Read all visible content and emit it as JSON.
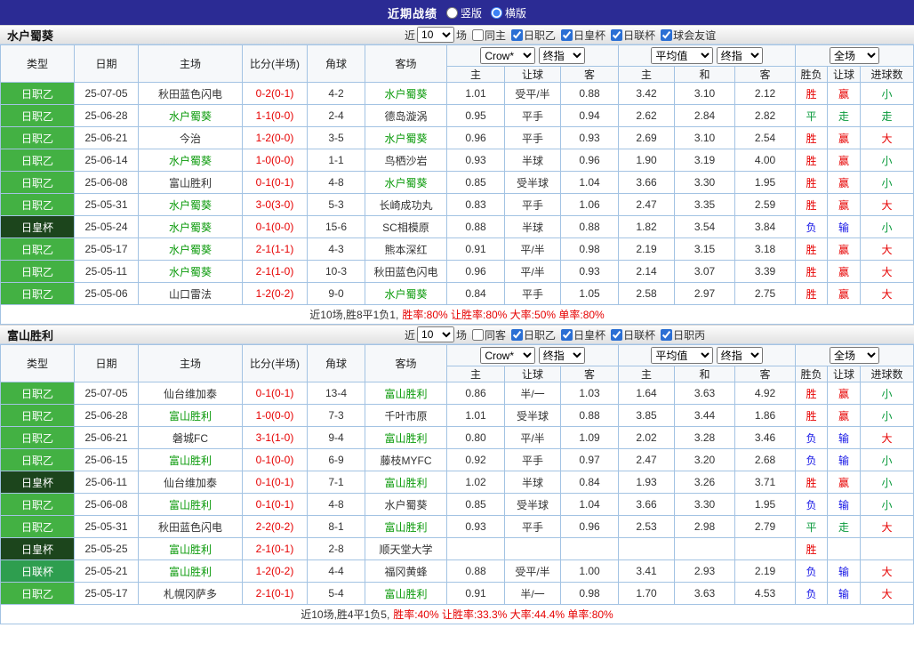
{
  "topbar": {
    "title": "近期战绩",
    "layout_options": [
      {
        "label": "竖版",
        "checked": false
      },
      {
        "label": "横版",
        "checked": true
      }
    ]
  },
  "filter_labels": {
    "near": "近",
    "games": "场"
  },
  "selects": {
    "count": "10",
    "bookmaker": "Crow*",
    "final_index_1": "终指",
    "average": "平均值",
    "final_index_2": "终指",
    "full_match": "全场"
  },
  "header_labels": {
    "type": "类型",
    "date": "日期",
    "home": "主场",
    "score": "比分(半场)",
    "corner": "角球",
    "away": "客场",
    "odds_home": "主",
    "odds_handicap": "让球",
    "odds_away": "客",
    "avg_home": "主",
    "avg_draw": "和",
    "avg_away": "客",
    "result_wdl": "胜负",
    "result_handicap": "让球",
    "result_goals": "进球数"
  },
  "sections": [
    {
      "team": "水户蜀葵",
      "filters": [
        {
          "label": "同主",
          "checked": false
        },
        {
          "label": "日职乙",
          "checked": true
        },
        {
          "label": "日皇杯",
          "checked": true
        },
        {
          "label": "日联杯",
          "checked": true
        },
        {
          "label": "球会友谊",
          "checked": true
        }
      ],
      "rows": [
        {
          "type": "日职乙",
          "date": "25-07-05",
          "home": "秋田蓝色闪电",
          "home_focus": false,
          "score": "0-2(0-1)",
          "corner": "4-2",
          "away": "水户蜀葵",
          "away_focus": true,
          "o1": "1.01",
          "handicap": "受平/半",
          "o2": "0.88",
          "a1": "3.42",
          "a2": "3.10",
          "a3": "2.12",
          "r1": "胜",
          "r2": "赢",
          "r3": "小"
        },
        {
          "type": "日职乙",
          "date": "25-06-28",
          "home": "水户蜀葵",
          "home_focus": true,
          "score": "1-1(0-0)",
          "corner": "2-4",
          "away": "德岛漩涡",
          "away_focus": false,
          "o1": "0.95",
          "handicap": "平手",
          "o2": "0.94",
          "a1": "2.62",
          "a2": "2.84",
          "a3": "2.82",
          "r1": "平",
          "r2": "走",
          "r3": "走"
        },
        {
          "type": "日职乙",
          "date": "25-06-21",
          "home": "今治",
          "home_focus": false,
          "score": "1-2(0-0)",
          "corner": "3-5",
          "away": "水户蜀葵",
          "away_focus": true,
          "o1": "0.96",
          "handicap": "平手",
          "o2": "0.93",
          "a1": "2.69",
          "a2": "3.10",
          "a3": "2.54",
          "r1": "胜",
          "r2": "赢",
          "r3": "大"
        },
        {
          "type": "日职乙",
          "date": "25-06-14",
          "home": "水户蜀葵",
          "home_focus": true,
          "score": "1-0(0-0)",
          "corner": "1-1",
          "away": "鸟栖沙岩",
          "away_focus": false,
          "o1": "0.93",
          "handicap": "半球",
          "o2": "0.96",
          "a1": "1.90",
          "a2": "3.19",
          "a3": "4.00",
          "r1": "胜",
          "r2": "赢",
          "r3": "小"
        },
        {
          "type": "日职乙",
          "date": "25-06-08",
          "home": "富山胜利",
          "home_focus": false,
          "score": "0-1(0-1)",
          "corner": "4-8",
          "away": "水户蜀葵",
          "away_focus": true,
          "o1": "0.85",
          "handicap": "受半球",
          "o2": "1.04",
          "a1": "3.66",
          "a2": "3.30",
          "a3": "1.95",
          "r1": "胜",
          "r2": "赢",
          "r3": "小"
        },
        {
          "type": "日职乙",
          "date": "25-05-31",
          "home": "水户蜀葵",
          "home_focus": true,
          "score": "3-0(3-0)",
          "corner": "5-3",
          "away": "长崎成功丸",
          "away_focus": false,
          "o1": "0.83",
          "handicap": "平手",
          "o2": "1.06",
          "a1": "2.47",
          "a2": "3.35",
          "a3": "2.59",
          "r1": "胜",
          "r2": "赢",
          "r3": "大"
        },
        {
          "type": "日皇杯",
          "date": "25-05-24",
          "home": "水户蜀葵",
          "home_focus": true,
          "score": "0-1(0-0)",
          "corner": "15-6",
          "away": "SC相模原",
          "away_focus": false,
          "o1": "0.88",
          "handicap": "半球",
          "o2": "0.88",
          "a1": "1.82",
          "a2": "3.54",
          "a3": "3.84",
          "r1": "负",
          "r2": "输",
          "r3": "小"
        },
        {
          "type": "日职乙",
          "date": "25-05-17",
          "home": "水户蜀葵",
          "home_focus": true,
          "score": "2-1(1-1)",
          "corner": "4-3",
          "away": "熊本深红",
          "away_focus": false,
          "o1": "0.91",
          "handicap": "平/半",
          "o2": "0.98",
          "a1": "2.19",
          "a2": "3.15",
          "a3": "3.18",
          "r1": "胜",
          "r2": "赢",
          "r3": "大"
        },
        {
          "type": "日职乙",
          "date": "25-05-11",
          "home": "水户蜀葵",
          "home_focus": true,
          "score": "2-1(1-0)",
          "corner": "10-3",
          "away": "秋田蓝色闪电",
          "away_focus": false,
          "o1": "0.96",
          "handicap": "平/半",
          "o2": "0.93",
          "a1": "2.14",
          "a2": "3.07",
          "a3": "3.39",
          "r1": "胜",
          "r2": "赢",
          "r3": "大"
        },
        {
          "type": "日职乙",
          "date": "25-05-06",
          "home": "山口雷法",
          "home_focus": false,
          "score": "1-2(0-2)",
          "corner": "9-0",
          "away": "水户蜀葵",
          "away_focus": true,
          "o1": "0.84",
          "handicap": "平手",
          "o2": "1.05",
          "a1": "2.58",
          "a2": "2.97",
          "a3": "2.75",
          "r1": "胜",
          "r2": "赢",
          "r3": "大"
        }
      ],
      "summary_prefix": "近10场,胜8平1负1,",
      "summary_stats": "胜率:80% 让胜率:80% 大率:50% 单率:80%"
    },
    {
      "team": "富山胜利",
      "filters": [
        {
          "label": "同客",
          "checked": false
        },
        {
          "label": "日职乙",
          "checked": true
        },
        {
          "label": "日皇杯",
          "checked": true
        },
        {
          "label": "日联杯",
          "checked": true
        },
        {
          "label": "日职丙",
          "checked": true
        }
      ],
      "rows": [
        {
          "type": "日职乙",
          "date": "25-07-05",
          "home": "仙台维加泰",
          "home_focus": false,
          "score": "0-1(0-1)",
          "corner": "13-4",
          "away": "富山胜利",
          "away_focus": true,
          "o1": "0.86",
          "handicap": "半/一",
          "o2": "1.03",
          "a1": "1.64",
          "a2": "3.63",
          "a3": "4.92",
          "r1": "胜",
          "r2": "赢",
          "r3": "小"
        },
        {
          "type": "日职乙",
          "date": "25-06-28",
          "home": "富山胜利",
          "home_focus": true,
          "score": "1-0(0-0)",
          "corner": "7-3",
          "away": "千叶市原",
          "away_focus": false,
          "o1": "1.01",
          "handicap": "受半球",
          "o2": "0.88",
          "a1": "3.85",
          "a2": "3.44",
          "a3": "1.86",
          "r1": "胜",
          "r2": "赢",
          "r3": "小"
        },
        {
          "type": "日职乙",
          "date": "25-06-21",
          "home": "磐城FC",
          "home_focus": false,
          "score": "3-1(1-0)",
          "corner": "9-4",
          "away": "富山胜利",
          "away_focus": true,
          "o1": "0.80",
          "handicap": "平/半",
          "o2": "1.09",
          "a1": "2.02",
          "a2": "3.28",
          "a3": "3.46",
          "r1": "负",
          "r2": "输",
          "r3": "大"
        },
        {
          "type": "日职乙",
          "date": "25-06-15",
          "home": "富山胜利",
          "home_focus": true,
          "score": "0-1(0-0)",
          "corner": "6-9",
          "away": "藤枝MYFC",
          "away_focus": false,
          "o1": "0.92",
          "handicap": "平手",
          "o2": "0.97",
          "a1": "2.47",
          "a2": "3.20",
          "a3": "2.68",
          "r1": "负",
          "r2": "输",
          "r3": "小"
        },
        {
          "type": "日皇杯",
          "date": "25-06-11",
          "home": "仙台维加泰",
          "home_focus": false,
          "score": "0-1(0-1)",
          "corner": "7-1",
          "away": "富山胜利",
          "away_focus": true,
          "o1": "1.02",
          "handicap": "半球",
          "o2": "0.84",
          "a1": "1.93",
          "a2": "3.26",
          "a3": "3.71",
          "r1": "胜",
          "r2": "赢",
          "r3": "小"
        },
        {
          "type": "日职乙",
          "date": "25-06-08",
          "home": "富山胜利",
          "home_focus": true,
          "score": "0-1(0-1)",
          "corner": "4-8",
          "away": "水户蜀葵",
          "away_focus": false,
          "o1": "0.85",
          "handicap": "受半球",
          "o2": "1.04",
          "a1": "3.66",
          "a2": "3.30",
          "a3": "1.95",
          "r1": "负",
          "r2": "输",
          "r3": "小"
        },
        {
          "type": "日职乙",
          "date": "25-05-31",
          "home": "秋田蓝色闪电",
          "home_focus": false,
          "score": "2-2(0-2)",
          "corner": "8-1",
          "away": "富山胜利",
          "away_focus": true,
          "o1": "0.93",
          "handicap": "平手",
          "o2": "0.96",
          "a1": "2.53",
          "a2": "2.98",
          "a3": "2.79",
          "r1": "平",
          "r2": "走",
          "r3": "大"
        },
        {
          "type": "日皇杯",
          "date": "25-05-25",
          "home": "富山胜利",
          "home_focus": true,
          "score": "2-1(0-1)",
          "corner": "2-8",
          "away": "顺天堂大学",
          "away_focus": false,
          "o1": "",
          "handicap": "",
          "o2": "",
          "a1": "",
          "a2": "",
          "a3": "",
          "r1": "胜",
          "r2": "",
          "r3": ""
        },
        {
          "type": "日联杯",
          "date": "25-05-21",
          "home": "富山胜利",
          "home_focus": true,
          "score": "1-2(0-2)",
          "corner": "4-4",
          "away": "福冈黄蜂",
          "away_focus": false,
          "o1": "0.88",
          "handicap": "受平/半",
          "o2": "1.00",
          "a1": "3.41",
          "a2": "2.93",
          "a3": "2.19",
          "r1": "负",
          "r2": "输",
          "r3": "大"
        },
        {
          "type": "日职乙",
          "date": "25-05-17",
          "home": "札幌冈萨多",
          "home_focus": false,
          "score": "2-1(0-1)",
          "corner": "5-4",
          "away": "富山胜利",
          "away_focus": true,
          "o1": "0.91",
          "handicap": "半/一",
          "o2": "0.98",
          "a1": "1.70",
          "a2": "3.63",
          "a3": "4.53",
          "r1": "负",
          "r2": "输",
          "r3": "大"
        }
      ],
      "summary_prefix": "近10场,胜4平1负5,",
      "summary_stats": "胜率:40% 让胜率:33.3% 大率:44.4% 单率:80%"
    }
  ]
}
